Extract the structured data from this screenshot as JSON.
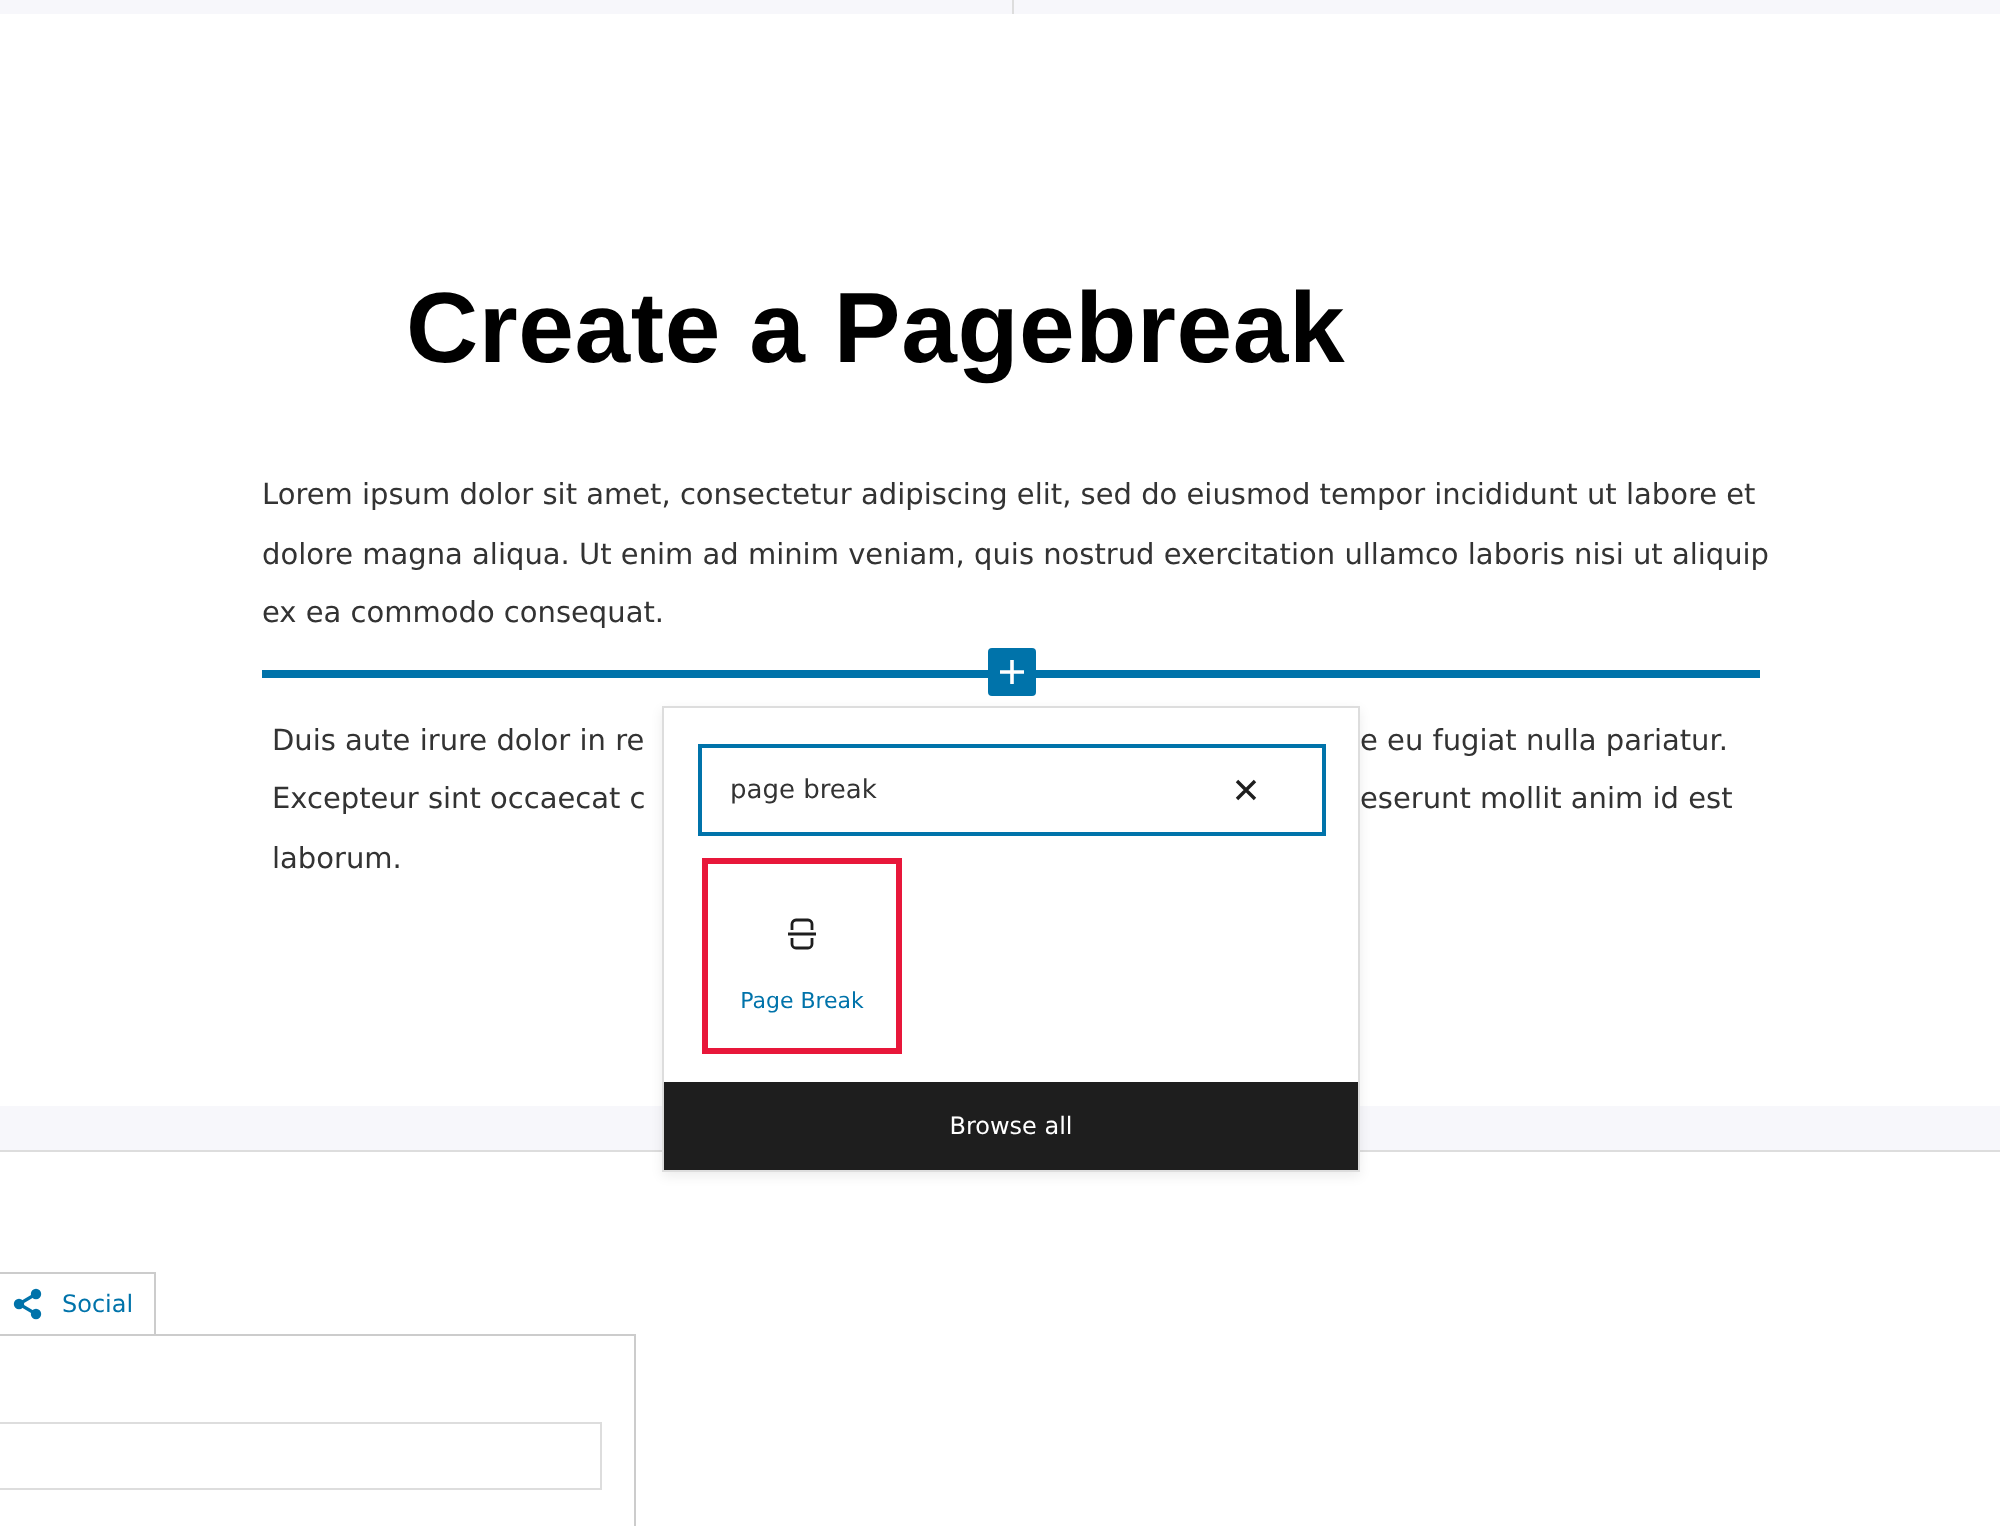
{
  "title": "Create a Pagebreak",
  "paragraph": "Lorem ipsum dolor sit amet, consectetur adipiscing elit, sed do eiusmod tempor incididunt ut labore et dolore magna aliqua. Ut enim ad minim veniam, quis nostrud exercitation ullamco laboris nisi ut aliquip ex ea commodo consequat.",
  "covered_paragraph_lines": [
    {
      "left": "Duis aute irure dolor in re",
      "right": "e eu fugiat nulla pariatur."
    },
    {
      "left": "Excepteur sint occaecat c",
      "right": "eserunt mollit anim id est"
    },
    {
      "left": "laborum."
    }
  ],
  "inserter": {
    "search_value": "page break",
    "results": [
      {
        "label": "Page Break",
        "selected": true
      }
    ],
    "browse_all": "Browse all"
  },
  "tabs": [
    {
      "label": "Social",
      "selected": true
    }
  ]
}
